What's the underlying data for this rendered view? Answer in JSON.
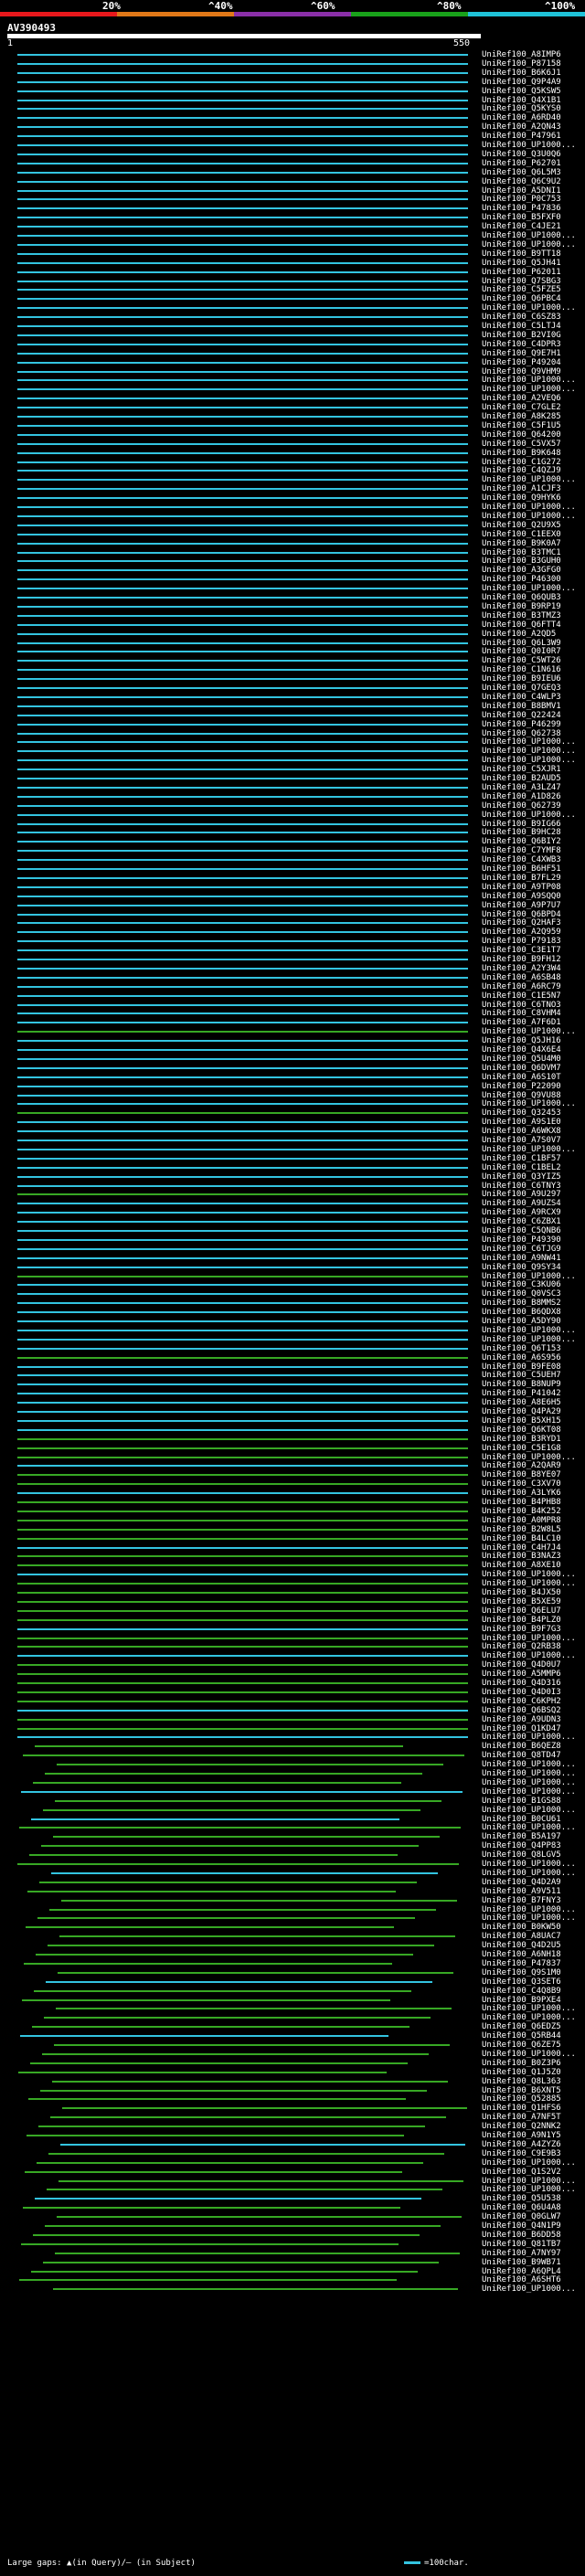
{
  "scale": {
    "labels": [
      "20%",
      "^40%",
      "^60%",
      "^80%",
      "^100%"
    ],
    "colors": [
      "#e8181c",
      "#e07818",
      "#8a2fa8",
      "#19a11a",
      "#1fc2d8"
    ]
  },
  "query": {
    "name": "AV390493",
    "start": "1",
    "end": "550"
  },
  "hit_colors": {
    "high": "#33c4e0",
    "mid": "#37a824"
  },
  "hits": [
    "UniRef100_A8IMP6",
    "UniRef100_P87158",
    "UniRef100_B6K6J1",
    "UniRef100_Q9P4A9",
    "UniRef100_Q5KSW5",
    "UniRef100_Q4X1B1",
    "UniRef100_Q5KYS0",
    "UniRef100_A6RD40",
    "UniRef100_A2QN43",
    "UniRef100_P47961",
    "UniRef100_UP1000...",
    "UniRef100_Q3U0Q6",
    "UniRef100_P62701",
    "UniRef100_Q6L5M3",
    "UniRef100_Q6C9U2",
    "UniRef100_A5DNI1",
    "UniRef100_P0C753",
    "UniRef100_P47836",
    "UniRef100_B5FXF0",
    "UniRef100_C4JE21",
    "UniRef100_UP1000...",
    "UniRef100_UP1000...",
    "UniRef100_B9TT18",
    "UniRef100_Q5JH41",
    "UniRef100_P62011",
    "UniRef100_Q7SBG3",
    "UniRef100_C5FZE5",
    "UniRef100_Q6PBC4",
    "UniRef100_UP1000...",
    "UniRef100_C6SZ83",
    "UniRef100_C5LTJ4",
    "UniRef100_B2VI0G",
    "UniRef100_C4DPR3",
    "UniRef100_Q9E7H1",
    "UniRef100_P49204",
    "UniRef100_Q9VHM9",
    "UniRef100_UP1000...",
    "UniRef100_UP1000...",
    "UniRef100_A2VEQ6",
    "UniRef100_C7GLE2",
    "UniRef100_A8K285",
    "UniRef100_C5F1U5",
    "UniRef100_Q64200",
    "UniRef100_C5VX57",
    "UniRef100_B9K648",
    "UniRef100_C1G272",
    "UniRef100_C4QZJ9",
    "UniRef100_UP1000...",
    "UniRef100_A1CJF3",
    "UniRef100_Q9HYK6",
    "UniRef100_UP1000...",
    "UniRef100_UP1000...",
    "UniRef100_Q2U9X5",
    "UniRef100_C1EEX0",
    "UniRef100_B9K0A7",
    "UniRef100_B3TMC1",
    "UniRef100_B3GUH0",
    "UniRef100_A3GFG0",
    "UniRef100_P46300",
    "UniRef100_UP1000...",
    "UniRef100_Q6QUB3",
    "UniRef100_B9RP19",
    "UniRef100_B3TMZ3",
    "UniRef100_Q6FTT4",
    "UniRef100_A2QD5",
    "UniRef100_Q6L3W9",
    "UniRef100_Q0I0R7",
    "UniRef100_C5WT26",
    "UniRef100_C1N616",
    "UniRef100_B9IEU6",
    "UniRef100_Q7GEQ3",
    "UniRef100_C4WLP3",
    "UniRef100_B8BMV1",
    "UniRef100_Q22424",
    "UniRef100_P46299",
    "UniRef100_Q62738",
    "UniRef100_UP1000...",
    "UniRef100_UP1000...",
    "UniRef100_UP1000...",
    "UniRef100_C5XJR1",
    "UniRef100_B2AUD5",
    "UniRef100_A3LZ47",
    "UniRef100_A1D826",
    "UniRef100_Q62739",
    "UniRef100_UP1000...",
    "UniRef100_B9IG66",
    "UniRef100_B9HC28",
    "UniRef100_Q6BIY2",
    "UniRef100_C7YMF8",
    "UniRef100_C4XWB3",
    "UniRef100_B6HF51",
    "UniRef100_B7FL29",
    "UniRef100_A9TP08",
    "UniRef100_A9SQQ0",
    "UniRef100_A9P7U7",
    "UniRef100_Q6BPD4",
    "UniRef100_Q2HAF3",
    "UniRef100_A2Q959",
    "UniRef100_P79183",
    "UniRef100_C3E1T7",
    "UniRef100_B9FH12",
    "UniRef100_A2Y3W4",
    "UniRef100_A6SB48",
    "UniRef100_A6RC79",
    "UniRef100_C1E5N7",
    "UniRef100_C6TNO3",
    "UniRef100_C8VHM4",
    "UniRef100_A7F6D1",
    "UniRef100_UP1000...",
    "UniRef100_Q5JH16",
    "UniRef100_Q4X6E4",
    "UniRef100_Q5U4M0",
    "UniRef100_Q6DVM7",
    "UniRef100_A6S10T",
    "UniRef100_P22090",
    "UniRef100_Q9VU88",
    "UniRef100_UP1000...",
    "UniRef100_Q32453",
    "UniRef100_A9S1E0",
    "UniRef100_A6WKX8",
    "UniRef100_A7S0V7",
    "UniRef100_UP1000...",
    "UniRef100_C1BF57",
    "UniRef100_C1BEL2",
    "UniRef100_Q3YIZ5",
    "UniRef100_C6TNY3",
    "UniRef100_A9U297",
    "UniRef100_A9UZS4",
    "UniRef100_A9RCX9",
    "UniRef100_C6ZBX1",
    "UniRef100_C5QNB6",
    "UniRef100_P49390",
    "UniRef100_C6TJG9",
    "UniRef100_A9NW41",
    "UniRef100_Q9SY34",
    "UniRef100_UP1000...",
    "UniRef100_C3KU06",
    "UniRef100_Q0VSC3",
    "UniRef100_B8MMS2",
    "UniRef100_B6QDX8",
    "UniRef100_A5DY90",
    "UniRef100_UP1000...",
    "UniRef100_UP1000...",
    "UniRef100_Q6T153",
    "UniRef100_A6S956",
    "UniRef100_B9FE08",
    "UniRef100_C5UEH7",
    "UniRef100_B8NUP9",
    "UniRef100_P41042",
    "UniRef100_A8E6H5",
    "UniRef100_Q4PA29",
    "UniRef100_B5XH15",
    "UniRef100_Q6KT08",
    "UniRef100_B3RYD1",
    "UniRef100_C5E1G8",
    "UniRef100_UP1000...",
    "UniRef100_A2QAR9",
    "UniRef100_B8YE07",
    "UniRef100_C3XV70",
    "UniRef100_A3LYK6",
    "UniRef100_B4PHB8",
    "UniRef100_B4K252",
    "UniRef100_A0MPR8",
    "UniRef100_B2W8L5",
    "UniRef100_B4LC10",
    "UniRef100_C4H7J4",
    "UniRef100_B3NAZ3",
    "UniRef100_A8XE10",
    "UniRef100_UP1000...",
    "UniRef100_UP1000...",
    "UniRef100_B4JX50",
    "UniRef100_B5XE59",
    "UniRef100_Q6ELU7",
    "UniRef100_B4PLZ0",
    "UniRef100_B9F7G3",
    "UniRef100_UP1000...",
    "UniRef100_Q2RB38",
    "UniRef100_UP1000...",
    "UniRef100_Q4D0U7",
    "UniRef100_A5MMP6",
    "UniRef100_Q4D316",
    "UniRef100_Q4D0I3",
    "UniRef100_C6KPH2",
    "UniRef100_Q6BSQ2",
    "UniRef100_A9UDN3",
    "UniRef100_Q1KD47",
    "UniRef100_UP1000...",
    "UniRef100_B6QEZ8",
    "UniRef100_Q8TD47",
    "UniRef100_UP1000...",
    "UniRef100_UP1000...",
    "UniRef100_UP1000...",
    "UniRef100_UP1000...",
    "UniRef100_B1GS88",
    "UniRef100_UP1000...",
    "UniRef100_B0CU61",
    "UniRef100_UP1000...",
    "UniRef100_B5A197",
    "UniRef100_Q4PP83",
    "UniRef100_Q8LGV5",
    "UniRef100_UP1000...",
    "UniRef100_UP1000...",
    "UniRef100_Q4D2A9",
    "UniRef100_A9V511",
    "UniRef100_B7FNY3",
    "UniRef100_UP1000...",
    "UniRef100_UP1000...",
    "UniRef100_B0KW50",
    "UniRef100_A8UAC7",
    "UniRef100_Q4D2U5",
    "UniRef100_A6NH18",
    "UniRef100_P47837",
    "UniRef100_Q9S1M0",
    "UniRef100_Q3SET6",
    "UniRef100_C4Q8B9",
    "UniRef100_B9PXE4",
    "UniRef100_UP1000...",
    "UniRef100_UP1000...",
    "UniRef100_Q6EDZ5",
    "UniRef100_Q5RB44",
    "UniRef100_Q6ZE75",
    "UniRef100_UP1000...",
    "UniRef100_B0Z3P6",
    "UniRef100_Q1J5Z0",
    "UniRef100_Q8L363",
    "UniRef100_B6XNT5",
    "UniRef100_Q52885",
    "UniRef100_Q1HFS6",
    "UniRef100_A7NF5T",
    "UniRef100_Q2NNK2",
    "UniRef100_A9N1Y5",
    "UniRef100_A4ZYZ6",
    "UniRef100_C9E9B3",
    "UniRef100_UP1000...",
    "UniRef100_Q1S2V2",
    "UniRef100_UP1000...",
    "UniRef100_UP1000...",
    "UniRef100_Q5U538",
    "UniRef100_Q6U4A8",
    "UniRef100_Q0GLW7",
    "UniRef100_Q4N1P9",
    "UniRef100_B6DD58",
    "UniRef100_Q81TB7",
    "UniRef100_A7NY97",
    "UniRef100_B9WB71",
    "UniRef100_A6QPL4",
    "UniRef100_A6SHT6",
    "UniRef100_UP1000..."
  ],
  "footer": {
    "large_gaps": "Large gaps: ▲(in Query)/— (in Subject)",
    "scale": "=100char."
  }
}
